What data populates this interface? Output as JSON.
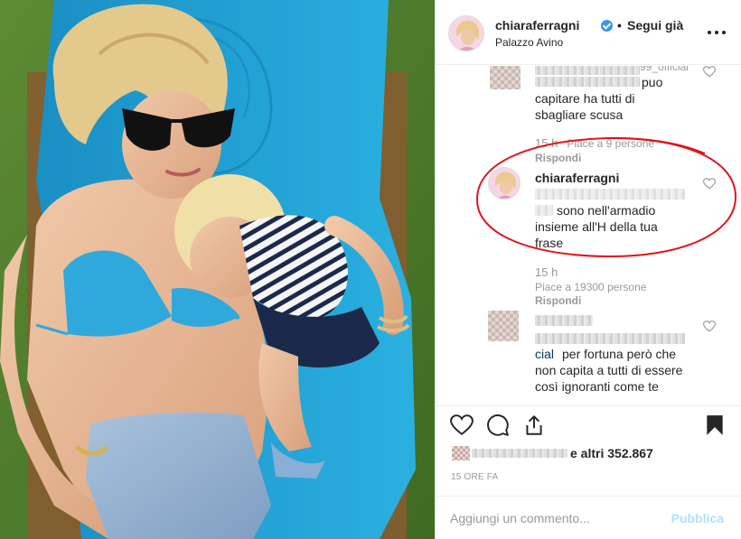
{
  "header": {
    "username": "chiaraferragni",
    "separator": "•",
    "follow_label": "Segui già",
    "location": "Palazzo Avino",
    "more_icon": "more-horizontal-icon"
  },
  "comments": [
    {
      "user_fragment": "99_official",
      "text": "può capitare ha tutti di sbagliare scusa",
      "line1": "puo",
      "line2": "capitare ha tutti di",
      "line3": "sbagliare scusa",
      "time": "15 h",
      "likes": "Piace a 9 persone",
      "reply": "Rispondi"
    },
    {
      "username": "chiaraferragni",
      "line1": "sono nell'armadio",
      "line2": "insieme all'H della tua",
      "line3": "frase",
      "time": "15 h",
      "likes": "Piace a 19300 persone",
      "reply": "Rispondi",
      "highlight_color": "#e0141c"
    },
    {
      "mention_fragment": "cial",
      "line1": "per fortuna però che",
      "line2": "non capita a tutti di essere",
      "line3": "così ignoranti come te"
    }
  ],
  "actions": {
    "like_icon": "heart-icon",
    "comment_icon": "comment-icon",
    "share_icon": "share-icon",
    "save_icon": "bookmark-icon",
    "likes_text": "e altri 352.867",
    "timestamp": "15 ORE FA"
  },
  "add_comment": {
    "placeholder": "Aggiungi un commento...",
    "post_label": "Pubblica",
    "post_color": "#b2dffc"
  },
  "colors": {
    "text": "#262626",
    "muted": "#999999",
    "verified": "#3897f0",
    "towel": "#1f9ccf"
  }
}
